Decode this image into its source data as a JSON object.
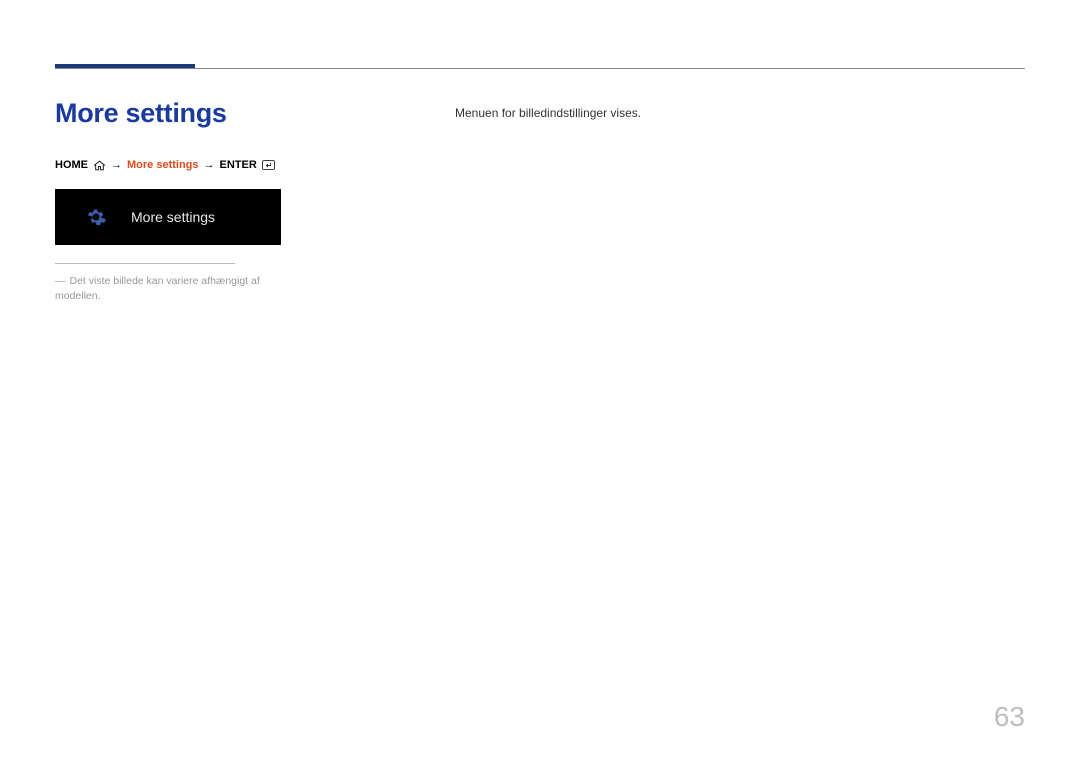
{
  "heading": "More settings",
  "breadcrumb": {
    "home": "HOME",
    "arrow1": "→",
    "more": "More settings",
    "arrow2": "→",
    "enter": "ENTER"
  },
  "tile": {
    "label": "More settings"
  },
  "footnote": {
    "dash": "―",
    "text": "Det viste billede kan variere afhængigt af modellen."
  },
  "body_text": "Menuen for billedindstillinger vises.",
  "page_number": "63"
}
